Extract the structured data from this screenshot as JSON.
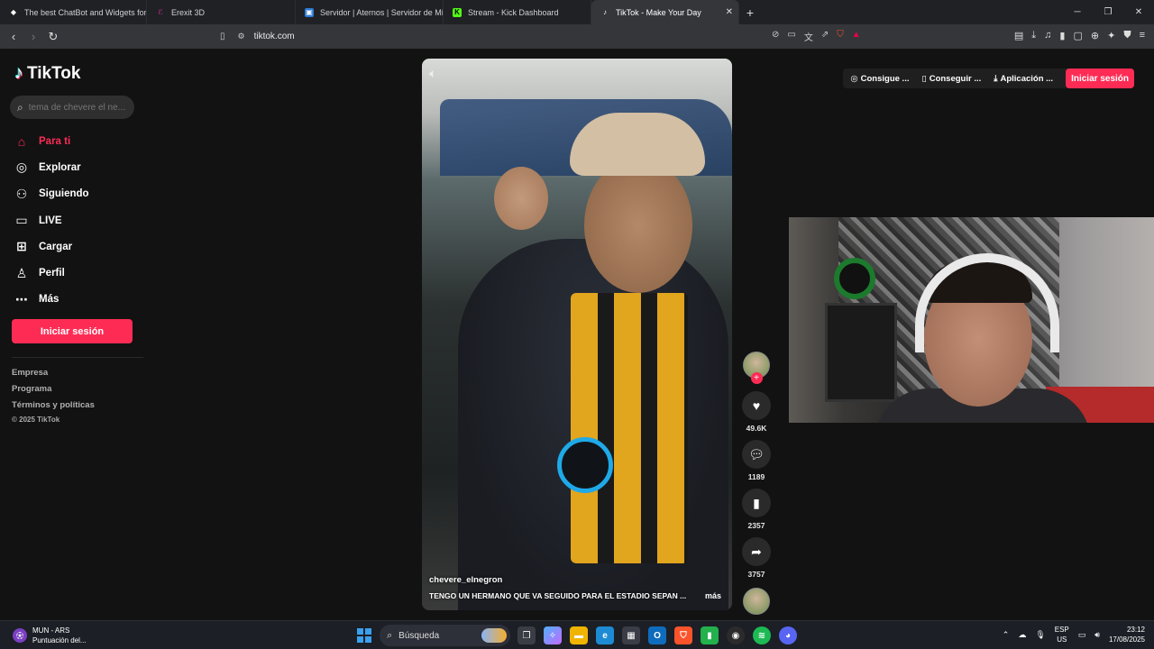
{
  "browser": {
    "tabs": [
      {
        "title": "The best ChatBot and Widgets for Ki",
        "icon": "streamelements-icon",
        "color": "#ffffff",
        "glyph": "◆"
      },
      {
        "title": "Erexit 3D",
        "icon": "erexit-icon",
        "color": "#a7287a",
        "glyph": "ℰ"
      },
      {
        "title": "Servidor | Aternos | Servidor de Mine",
        "icon": "aternos-icon",
        "color": "#2e7bd6",
        "glyph": "▣"
      },
      {
        "title": "Stream - Kick Dashboard",
        "icon": "kick-icon",
        "color": "#53fc18",
        "glyph": "K"
      },
      {
        "title": "TikTok - Make Your Day",
        "icon": "tiktok-icon",
        "color": "#ffffff",
        "glyph": "♪"
      }
    ],
    "url": "tiktok.com"
  },
  "sidebar": {
    "logo": "TikTok",
    "search_placeholder": "tema de chevere el ne...",
    "nav": [
      {
        "label": "Para ti",
        "icon": "home-icon",
        "glyph": "⌂"
      },
      {
        "label": "Explorar",
        "icon": "compass-icon",
        "glyph": "◎"
      },
      {
        "label": "Siguiendo",
        "icon": "following-icon",
        "glyph": "⚇"
      },
      {
        "label": "LIVE",
        "icon": "live-icon",
        "glyph": "▭"
      },
      {
        "label": "Cargar",
        "icon": "upload-icon",
        "glyph": "⊞"
      },
      {
        "label": "Perfil",
        "icon": "profile-icon",
        "glyph": "♙"
      },
      {
        "label": "Más",
        "icon": "more-icon",
        "glyph": "⋯"
      }
    ],
    "login": "Iniciar sesión",
    "footer": [
      "Empresa",
      "Programa",
      "Términos y políticas"
    ],
    "copyright": "© 2025 TikTok"
  },
  "topbar": {
    "buttons": [
      "Consigue ...",
      "Conseguir ...",
      "Aplicación ..."
    ],
    "login": "Iniciar sesión"
  },
  "video": {
    "username": "chevere_elnegron",
    "caption": "TENGO UN HERMANO QUE VA SEGUIDO PARA EL ESTADIO SEPAN ...",
    "more": "más",
    "likes": "49.6K",
    "comments": "1189",
    "saves": "2357",
    "shares": "3757"
  },
  "taskbar": {
    "weather_title": "MUN - ARS",
    "weather_sub": "Puntuación del...",
    "search": "Búsqueda",
    "lang1": "ESP",
    "lang2": "US",
    "time": "23:12",
    "date": "17/08/2025"
  },
  "colors": {
    "accent": "#fe2c55"
  }
}
